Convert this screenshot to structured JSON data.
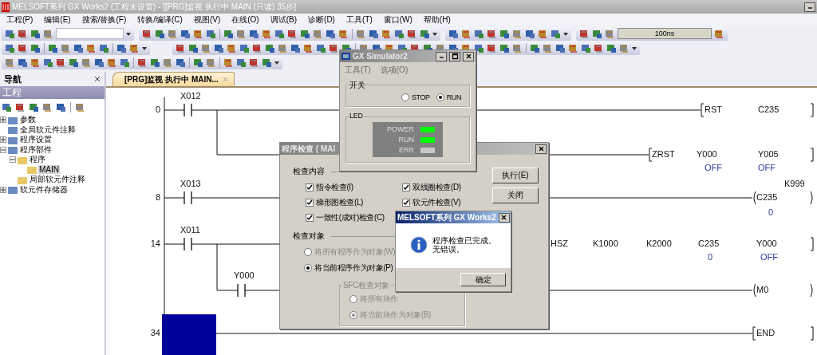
{
  "window": {
    "title": "MELSOFT系列 GX Works2 (工程未设置) - [[PRG]监视 执行中 MAIN (只读) 35步]"
  },
  "menu": [
    "工程(P)",
    "编辑(E)",
    "搜索/替换(F)",
    "转换/编译(C)",
    "视图(V)",
    "在线(O)",
    "调试(B)",
    "诊断(D)",
    "工具(T)",
    "窗口(W)",
    "帮助(H)"
  ],
  "toolbar": {
    "scan_time": "100ns"
  },
  "navigation": {
    "title": "导航",
    "section": "工程",
    "tree": [
      {
        "label": "参数",
        "expanded": false,
        "selected": false
      },
      {
        "label": "全局软元件注释",
        "selected": false
      },
      {
        "label": "程序设置",
        "expanded": false,
        "selected": false
      },
      {
        "label": "程序部件",
        "expanded": true,
        "selected": false,
        "children": [
          {
            "label": "程序",
            "expanded": true,
            "selected": false,
            "children": [
              {
                "label": "MAIN",
                "selected": true
              }
            ]
          },
          {
            "label": "局部软元件注释",
            "selected": false
          }
        ]
      },
      {
        "label": "软元件存储器",
        "expanded": false,
        "selected": false
      }
    ]
  },
  "tabs": [
    {
      "label": "[PRG]监视 执行中 MAIN...",
      "selected": true
    }
  ],
  "ladder": {
    "rungs": [
      {
        "step": "0",
        "contact": "X012",
        "instruction": "RST",
        "operands": [
          {
            "device": "C235"
          }
        ],
        "branch": {
          "instruction": "ZRST",
          "operands": [
            {
              "device": "Y000",
              "value": "OFF"
            },
            {
              "device": "Y005",
              "value": "OFF"
            }
          ]
        }
      },
      {
        "step": "8",
        "contact": "X013",
        "coil": "C235",
        "setting": "K999",
        "value": "0"
      },
      {
        "step": "14",
        "contact": "X011",
        "instruction": "HSZ",
        "operands": [
          {
            "device": "K1000"
          },
          {
            "device": "K2000"
          },
          {
            "device": "C235",
            "value": "0"
          },
          {
            "device": "Y000",
            "value": "OFF"
          }
        ],
        "branch": {
          "contact": "Y000",
          "coil": "M0"
        }
      },
      {
        "step": "34",
        "instruction": "END"
      }
    ]
  },
  "simulator": {
    "title": "GX Simulator2",
    "menu": [
      {
        "label": "工具(T)",
        "disabled": true
      },
      {
        "label": "选项(O)",
        "disabled": true
      }
    ],
    "switch_title": "开关",
    "switch": [
      {
        "label": "STOP",
        "selected": false
      },
      {
        "label": "RUN",
        "selected": true
      }
    ],
    "led_title": "LED",
    "leds": [
      {
        "label": "POWER",
        "on": true
      },
      {
        "label": "RUN",
        "on": true
      },
      {
        "label": "ERR",
        "on": false
      }
    ]
  },
  "check_dialog": {
    "title": "程序检查 ( MAI",
    "content_title": "检查内容",
    "checks": [
      {
        "label": "指令检查(I)",
        "checked": true
      },
      {
        "label": "梯形图检查(L)",
        "checked": true
      },
      {
        "label": "一致性(成对)检查(C)",
        "checked": true
      },
      {
        "label": "双线圈检查(D)",
        "checked": true
      },
      {
        "label": "软元件检查(V)",
        "checked": true
      }
    ],
    "buttons": [
      "执行(E)",
      "关闭"
    ],
    "target_title": "检查对象",
    "targets": [
      {
        "label": "将所有程序作为对象(W)",
        "selected": false,
        "disabled": true
      },
      {
        "label": "将当前程序作为对象(P)",
        "selected": true,
        "disabled": false
      }
    ],
    "sfc_title": "SFC检查对象",
    "sfc_targets": [
      {
        "label": "将所有块作",
        "selected": false,
        "disabled": true
      },
      {
        "label": "将当前块作为对象(B)",
        "selected": true,
        "disabled": true
      }
    ]
  },
  "message_box": {
    "title": "MELSOFT系列 GX Works2",
    "message": [
      "程序检查已完成。",
      "无错误。"
    ],
    "button": "确定"
  }
}
